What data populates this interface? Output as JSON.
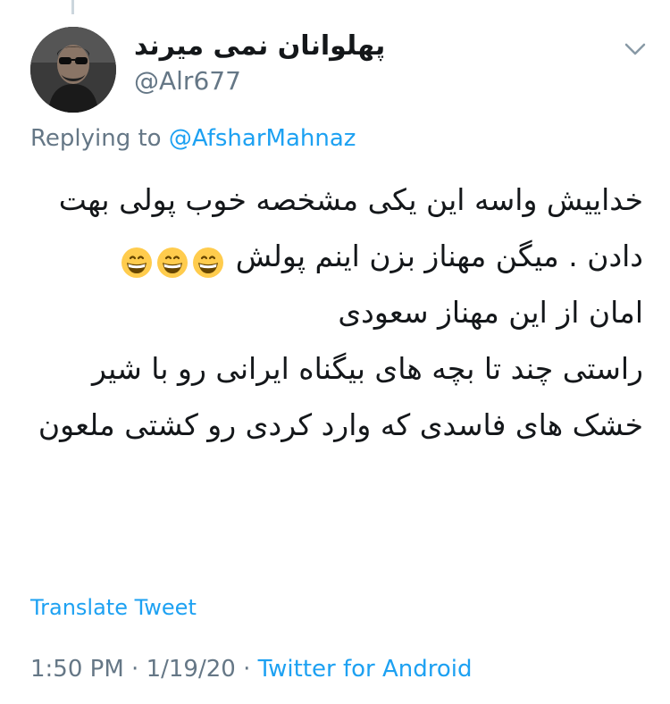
{
  "tweet": {
    "display_name": "پهلوانان نمی میرند",
    "handle": "@Alr677",
    "replying_prefix": "Replying to",
    "replying_to": "@AfsharMahnaz",
    "paragraphs": [
      "خداییش واسه این یکی مشخصه خوب پولی بهت دادن . میگن مهناز بزن اینم پولش",
      "امان از این مهناز سعودی",
      "راستی چند تا بچه های بیگناه ایرانی رو با شیر خشک های فاسدی که وارد کردی رو کشتی ملعون"
    ],
    "emoji": "grinning-face-with-smiling-eyes",
    "emoji_count": 3,
    "translate_label": "Translate Tweet",
    "time": "1:50 PM",
    "separator": "·",
    "date": "1/19/20",
    "source": "Twitter for Android"
  },
  "colors": {
    "link": "#1da1f2",
    "secondary": "#657786",
    "text": "#14171a"
  },
  "icons": {
    "caret": "chevron-down-icon",
    "avatar": "user-avatar"
  }
}
